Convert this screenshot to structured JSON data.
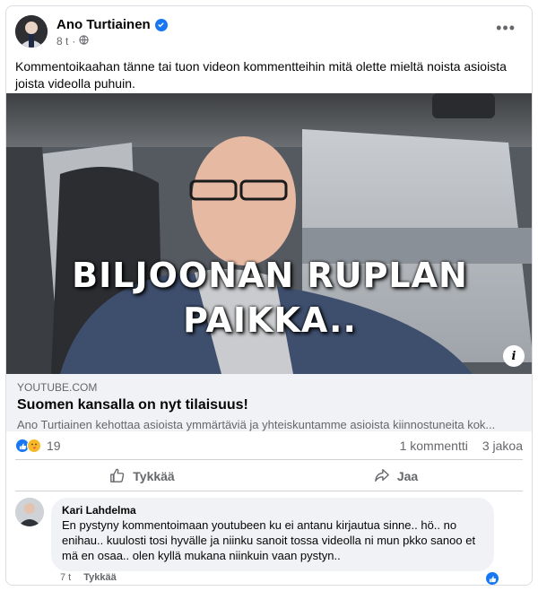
{
  "post": {
    "author": "Ano Turtiainen",
    "time": "8 t",
    "privacy_icon": "globe-icon",
    "verified_icon": "verified-badge-icon",
    "text": "Kommentoikaahan tänne tai tuon videon kommentteihin mitä olette mieltä noista asioista joista videolla puhuin."
  },
  "video": {
    "overlay_line1": "BILJOONAN RUPLAN",
    "overlay_line2": "PAIKKA..",
    "info_label": "i"
  },
  "link": {
    "domain": "YOUTUBE.COM",
    "title": "Suomen kansalla on nyt tilaisuus!",
    "description": "Ano Turtiainen kehottaa asioista ymmärtäviä ja yhteiskuntamme asioista kiinnostuneita kok..."
  },
  "reactions": {
    "count": "19",
    "comments": "1 kommentti",
    "shares": "3 jakoa",
    "icons": [
      "like-reaction-icon",
      "care-reaction-icon"
    ]
  },
  "actions": {
    "like_label": "Tykkää",
    "share_label": "Jaa"
  },
  "comment": {
    "author": "Kari Lahdelma",
    "text": "En pystyny kommentoimaan youtubeen ku ei antanu kirjautua sinne.. hö.. no enihau.. kuulosti tosi hyvälle ja niinku sanoit tossa videolla ni mun pkko sanoo et mä en osaa.. olen kyllä mukana niinkuin vaan pystyn..",
    "time": "7 t",
    "like_label": "Tykkää"
  },
  "colors": {
    "accent": "#1877f2",
    "secondary_text": "#65676b",
    "bubble": "#f0f2f5"
  }
}
